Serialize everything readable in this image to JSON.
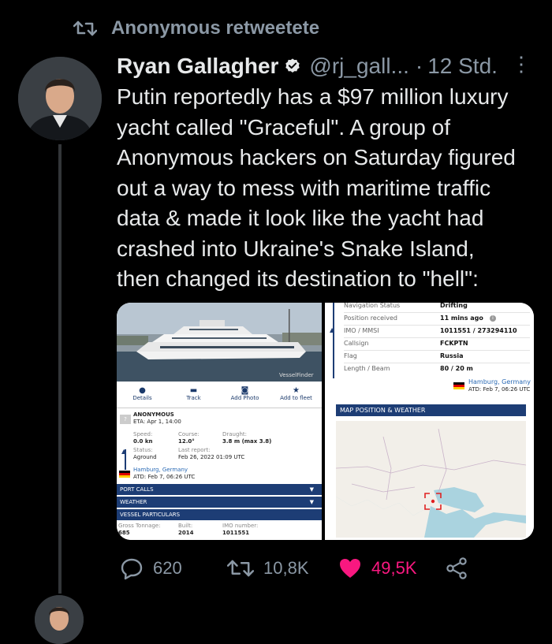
{
  "retweet": {
    "label": "Anonymous retweetete"
  },
  "author": {
    "name": "Ryan Gallagher",
    "handle": "@rj_gall...",
    "separator": "·",
    "time": "12 Std."
  },
  "tweet": {
    "text": "Putin reportedly has a $97 million luxury\nyacht called \"Graceful\". A group of\nAnonymous hackers on Saturday figured\nout a way to mess with maritime traffic\ndata & made it look like the yacht had\ncrashed into Ukraine's Snake Island,\nthen changed its destination to \"hell\":"
  },
  "left_image": {
    "watermark": "VesselFinder",
    "tabs": [
      "Details",
      "Track",
      "Add Photo",
      "Add to fleet"
    ],
    "destination": "ANONYMOUS",
    "eta": "ETA: Apr 1, 14:00",
    "speed_label": "Speed:",
    "speed_value": "0.0 kn",
    "course_label": "Course:",
    "course_value": "12.0°",
    "draught_label": "Draught:",
    "draught_value": "3.8 m (max 3.8)",
    "status_label": "Status:",
    "status_value": "Aground",
    "report_label": "Last report:",
    "report_value": "Feb 26, 2022 01:09 UTC",
    "port": "Hamburg, Germany",
    "atd": "ATD: Feb 7, 06:26 UTC",
    "bars": [
      "PORT CALLS",
      "WEATHER",
      "VESSEL PARTICULARS"
    ],
    "tonnage_label": "Gross Tonnage:",
    "tonnage_value": "685",
    "built_label": "Built:",
    "built_value": "2014",
    "imo_label": "IMO number:",
    "imo_value": "1011551"
  },
  "right_image": {
    "rows": [
      {
        "k": "Navigation Status",
        "v": "Drifting"
      },
      {
        "k": "Position received",
        "v": "11 mins ago"
      },
      {
        "k": "IMO / MMSI",
        "v": "1011551 / 273294110"
      },
      {
        "k": "Callsign",
        "v": "FCKPTN"
      },
      {
        "k": "Flag",
        "v": "Russia"
      },
      {
        "k": "Length / Beam",
        "v": "80 / 20 m"
      }
    ],
    "port": "Hamburg, Germany",
    "atd": "ATD: Feb 7, 06:26 UTC",
    "map_title": "MAP POSITION & WEATHER"
  },
  "actions": {
    "replies": "620",
    "retweets": "10,8K",
    "likes": "49,5K"
  },
  "colors": {
    "background": "#000000",
    "muted": "#8b98a5",
    "like": "#f91880",
    "verified": "#1d9bf0",
    "bar": "#1d3d75"
  }
}
